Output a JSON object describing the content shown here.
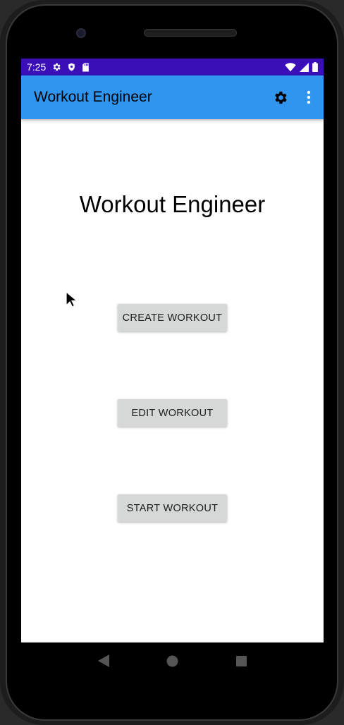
{
  "status_bar": {
    "time": "7:25",
    "left_icons": [
      "settings-icon",
      "shield-icon",
      "sd-card-icon"
    ],
    "right_icons": [
      "wifi-icon",
      "cell-signal-icon",
      "battery-icon"
    ],
    "background": "#3a0fb7"
  },
  "app_bar": {
    "title": "Workout Engineer",
    "actions": [
      "settings-icon",
      "overflow-menu-icon"
    ],
    "background": "#2f95ef"
  },
  "main": {
    "heading": "Workout Engineer",
    "buttons": {
      "create": "CREATE WORKOUT",
      "edit": "EDIT WORKOUT",
      "start": "START WORKOUT"
    }
  },
  "nav_bar": {
    "items": [
      "back-icon",
      "home-icon",
      "recents-icon"
    ]
  }
}
